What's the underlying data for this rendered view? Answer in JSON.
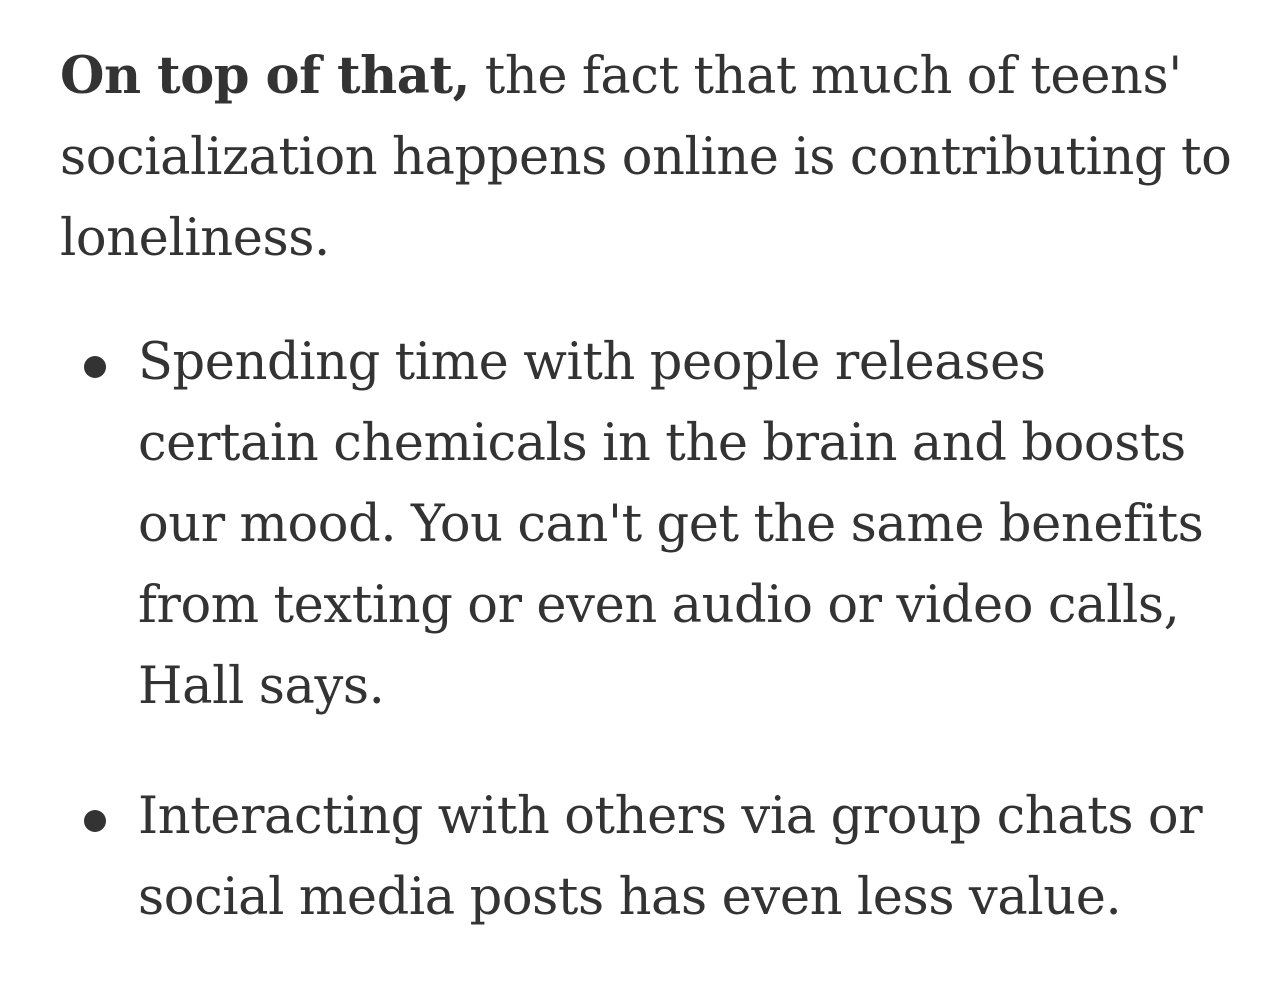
{
  "article": {
    "intro": {
      "lead_bold": "On top of that,",
      "rest": " the fact that much of teens' socialization happens online is contributing to loneliness."
    },
    "bullets": [
      {
        "text": "Spending time with people releases certain chemicals in the brain and boosts our mood. You can't get the same benefits from texting or even audio or video calls, Hall says."
      },
      {
        "text": "Interacting with others via group chats or social media posts has even less value."
      }
    ]
  }
}
